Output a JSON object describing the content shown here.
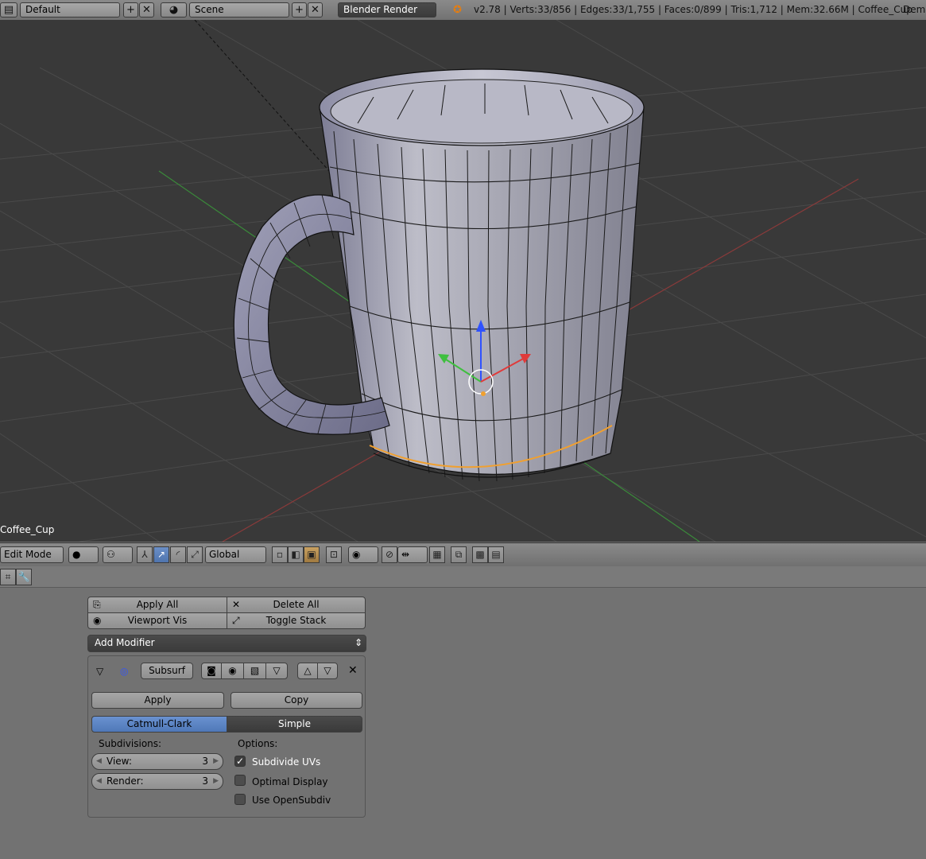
{
  "topbar": {
    "screen_layout": "Default",
    "scene": "Scene",
    "render_engine": "Blender Render",
    "stats": "v2.78 | Verts:33/856 | Edges:33/1,755 | Faces:0/899 | Tris:1,712 | Mem:32.66M | Coffee_Cup",
    "right_cut": "Demo"
  },
  "viewport": {
    "object_label": "Coffee_Cup"
  },
  "header3d": {
    "mode": "Edit Mode",
    "orientation": "Global"
  },
  "modifiers": {
    "apply_all": "Apply All",
    "delete_all": "Delete All",
    "viewport_vis": "Viewport Vis",
    "toggle_stack": "Toggle Stack",
    "add_modifier": "Add Modifier",
    "modifier_name": "Subsurf",
    "apply": "Apply",
    "copy": "Copy",
    "tabs": [
      "Catmull-Clark",
      "Simple"
    ],
    "active_tab": "Catmull-Clark",
    "subdivisions_label": "Subdivisions:",
    "view_label": "View:",
    "view_value": "3",
    "render_label": "Render:",
    "render_value": "3",
    "options_label": "Options:",
    "options": [
      {
        "label": "Subdivide UVs",
        "checked": true
      },
      {
        "label": "Optimal Display",
        "checked": false
      },
      {
        "label": "Use OpenSubdiv",
        "checked": false
      }
    ]
  },
  "colors": {
    "viewport_bg": "#393939",
    "panel_bg": "#727272",
    "accent_blue": "#5680c2",
    "axis_red": "#e03a3a",
    "axis_green": "#3fbf3f",
    "axis_blue": "#2f52ff",
    "selection_orange": "#f0a030"
  }
}
